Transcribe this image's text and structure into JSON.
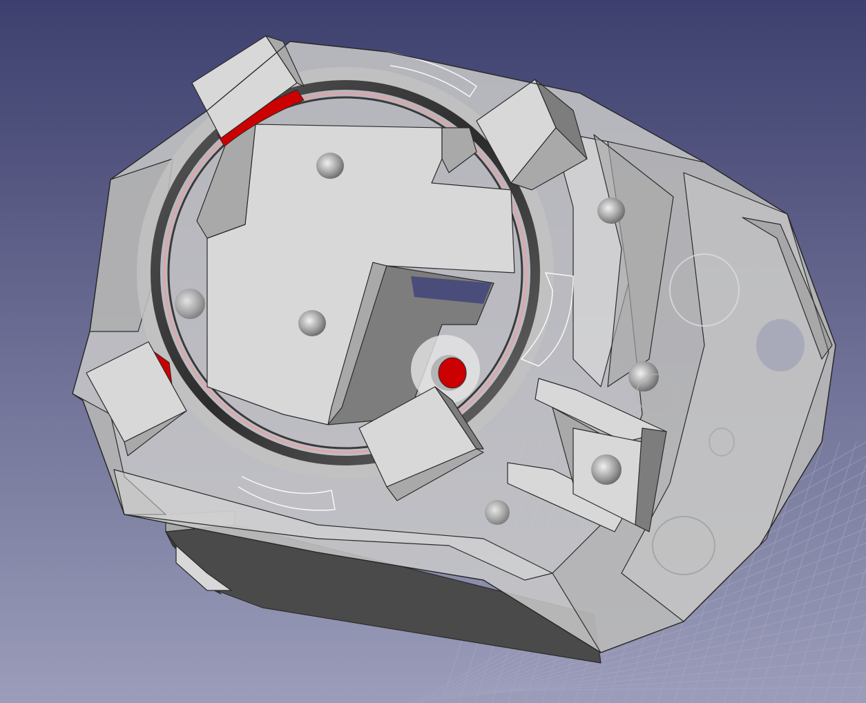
{
  "viewport": {
    "background_top": "#3d3f6e",
    "background_bottom": "#9b9dba",
    "grid_color": "#a9abc4"
  },
  "model": {
    "body_color": "#c9c9c9",
    "body_face_light": "#d8d8d8",
    "body_face_mid": "#a9a9a9",
    "body_face_dark": "#7d7d7d",
    "motor_color": "#4a4a4a",
    "motor_dark": "#3a3a3a",
    "highlight_color": "#cc0000",
    "edge_color": "#2a2a2a",
    "selection_edge_color": "#ffffff"
  }
}
